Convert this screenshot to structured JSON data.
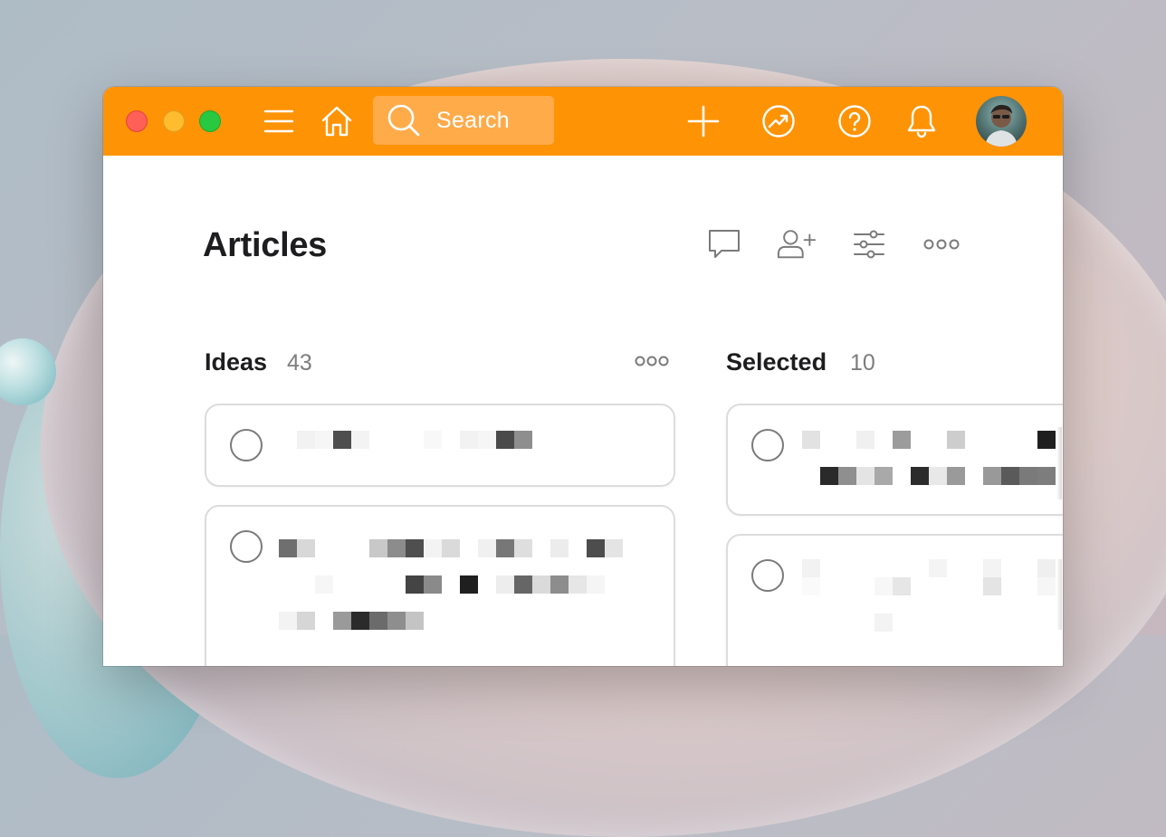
{
  "toolbar": {
    "search_placeholder": "Search",
    "accent_color": "#ff9306"
  },
  "main": {
    "title": "Articles"
  },
  "columns": [
    {
      "title": "Ideas",
      "count": "43"
    },
    {
      "title": "Selected",
      "count": "10"
    }
  ],
  "icons": [
    "menu-icon",
    "home-icon",
    "search-icon",
    "plus-icon",
    "trending-icon",
    "help-icon",
    "bell-icon",
    "comment-icon",
    "add-person-icon",
    "filter-icon",
    "more-icon"
  ]
}
